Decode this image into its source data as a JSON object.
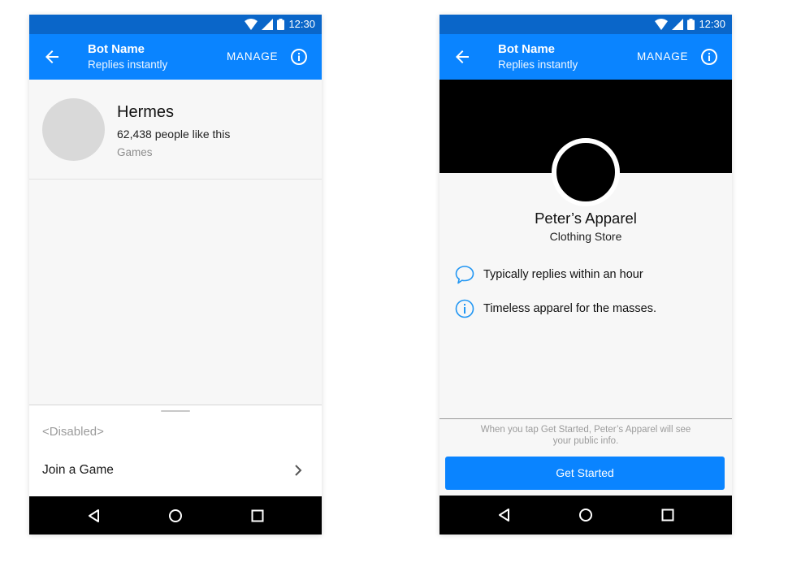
{
  "colors": {
    "status_bar": "#0a66c9",
    "app_bar": "#0a84ff",
    "accent": "#0a84ff",
    "nav_bar": "#000000",
    "cover": "#000000"
  },
  "left_phone": {
    "status": {
      "time": "12:30",
      "icons": [
        "wifi-icon",
        "signal-icon",
        "battery-icon"
      ]
    },
    "app_bar": {
      "title": "Bot Name",
      "subtitle": "Replies instantly",
      "manage_label": "MANAGE",
      "back_icon": "arrow-back-icon",
      "info_icon": "info-icon"
    },
    "profile": {
      "name": "Hermes",
      "likes": "62,438 people like this",
      "category": "Games"
    },
    "sheet": {
      "disabled_text": "<Disabled>",
      "item_label": "Join a Game",
      "item_icon": "chevron-right-icon"
    },
    "nav": {
      "icons": [
        "back-triangle-icon",
        "home-circle-icon",
        "recents-square-icon"
      ]
    }
  },
  "right_phone": {
    "status": {
      "time": "12:30",
      "icons": [
        "wifi-icon",
        "signal-icon",
        "battery-icon"
      ]
    },
    "app_bar": {
      "title": "Bot Name",
      "subtitle": "Replies instantly",
      "manage_label": "MANAGE",
      "back_icon": "arrow-back-icon",
      "info_icon": "info-icon"
    },
    "page": {
      "name": "Peter’s Apparel",
      "category": "Clothing Store",
      "details": [
        {
          "icon": "speech-bubble-icon",
          "text": "Typically replies within an hour"
        },
        {
          "icon": "info-icon",
          "text": "Timeless apparel for the masses."
        }
      ]
    },
    "footer": {
      "disclaimer": "When you tap Get Started, Peter’s Apparel will see your public info.",
      "cta_label": "Get Started"
    },
    "nav": {
      "icons": [
        "back-triangle-icon",
        "home-circle-icon",
        "recents-square-icon"
      ]
    }
  }
}
